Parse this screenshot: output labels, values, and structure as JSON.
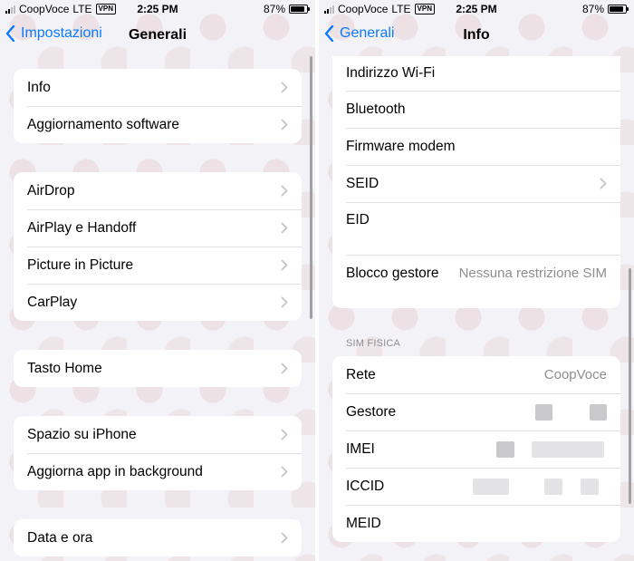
{
  "status": {
    "carrier": "CoopVoce",
    "network": "LTE",
    "vpn": "VPN",
    "time": "2:25 PM",
    "battery": "87%",
    "battery_level": 0.87
  },
  "left": {
    "back_label": "Impostazioni",
    "title": "Generali",
    "groups": [
      [
        "Info",
        "Aggiornamento software"
      ],
      [
        "AirDrop",
        "AirPlay e Handoff",
        "Picture in Picture",
        "CarPlay"
      ],
      [
        "Tasto Home"
      ],
      [
        "Spazio su iPhone",
        "Aggiorna app in background"
      ],
      [
        "Data e ora"
      ]
    ]
  },
  "right": {
    "back_label": "Generali",
    "title": "Info",
    "group1": {
      "wifi": "Indirizzo Wi-Fi",
      "bluetooth": "Bluetooth",
      "firmware": "Firmware modem",
      "seid": "SEID",
      "eid": "EID",
      "lock_label": "Blocco gestore",
      "lock_value": "Nessuna restrizione SIM"
    },
    "sim_header": "SIM FISICA",
    "group2": {
      "network_label": "Rete",
      "network_value": "CoopVoce",
      "carrier_label": "Gestore",
      "imei_label": "IMEI",
      "iccid_label": "ICCID",
      "meid_label": "MEID"
    }
  },
  "colors": {
    "accent": "#0a7aff",
    "background": "#f2f2f7",
    "secondary_text": "#8e8e93"
  }
}
